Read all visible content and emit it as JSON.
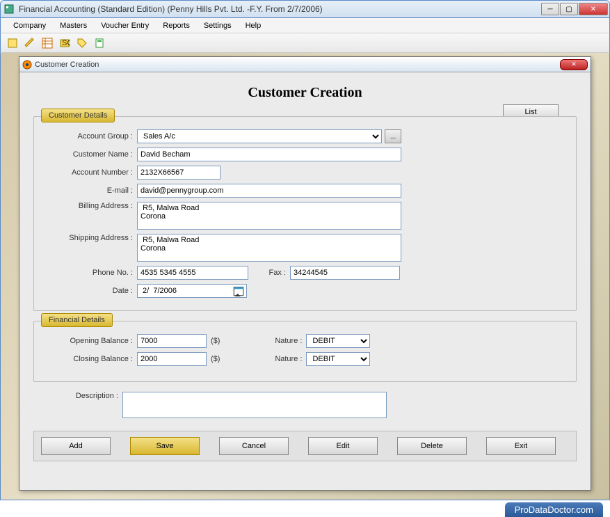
{
  "window": {
    "title": "Financial Accounting (Standard Edition) (Penny Hills Pvt. Ltd. -F.Y. From 2/7/2006)"
  },
  "menu": [
    "Company",
    "Masters",
    "Voucher Entry",
    "Reports",
    "Settings",
    "Help"
  ],
  "dialog": {
    "title": "Customer Creation",
    "heading": "Customer Creation",
    "list_btn": "List",
    "section1": "Customer Details",
    "section2": "Financial Details",
    "labels": {
      "account_group": "Account Group :",
      "customer_name": "Customer Name :",
      "account_number": "Account Number :",
      "email": "E-mail :",
      "billing": "Billing Address :",
      "shipping": "Shipping Address :",
      "phone": "Phone No. :",
      "fax": "Fax :",
      "date": "Date :",
      "opening": "Opening Balance :",
      "closing": "Closing Balance :",
      "nature": "Nature :",
      "description": "Description :",
      "currency": "($)"
    },
    "fields": {
      "account_group": "Sales A/c",
      "customer_name": "David Becham",
      "account_number": "2132X66567",
      "email": "david@pennygroup.com",
      "billing": " R5, Malwa Road\nCorona",
      "shipping": " R5, Malwa Road\nCorona",
      "phone": "4535 5345 4555",
      "fax": "34244545",
      "date": " 2/  7/2006",
      "opening": "7000",
      "closing": "2000",
      "nature1": "DEBIT",
      "nature2": "DEBIT",
      "description": ""
    },
    "dots": "...",
    "buttons": {
      "add": "Add",
      "save": "Save",
      "cancel": "Cancel",
      "edit": "Edit",
      "delete": "Delete",
      "exit": "Exit"
    }
  },
  "footer": "ProDataDoctor.com"
}
